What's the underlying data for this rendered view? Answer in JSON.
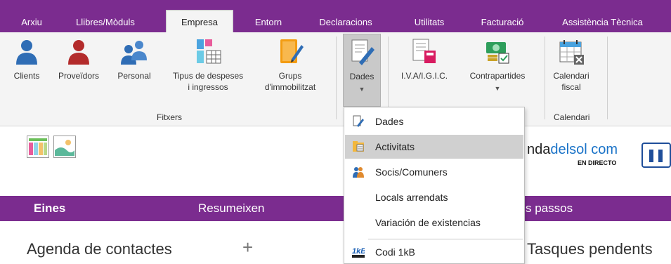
{
  "menubar": {
    "tabs": [
      {
        "label": "Arxiu"
      },
      {
        "label": "Llibres/Mòduls"
      },
      {
        "label": "Empresa"
      },
      {
        "label": "Entorn"
      },
      {
        "label": "Declaracions"
      },
      {
        "label": "Utilitats"
      },
      {
        "label": "Facturació"
      },
      {
        "label": "Assistència Tècnica"
      }
    ],
    "active_tab": "Empresa"
  },
  "ribbon": {
    "buttons": {
      "clients": "Clients",
      "proveidors": "Proveïdors",
      "personal": "Personal",
      "tipus_line1": "Tipus de despeses",
      "tipus_line2": "i ingressos",
      "grups_line1": "Grups",
      "grups_line2": "d'immobilitzat",
      "dades": "Dades",
      "iva": "I.V.A/I.G.I.C.",
      "contrapartides": "Contrapartides",
      "calendari_line1": "Calendari",
      "calendari_line2": "fiscal"
    },
    "groups": {
      "fitxers": "Fitxers",
      "calendari": "Calendari"
    }
  },
  "dropdown": {
    "items": [
      {
        "label": "Dades",
        "icon": "edit-document-icon"
      },
      {
        "label": "Activitats",
        "icon": "folder-list-icon"
      },
      {
        "label": "Socis/Comuners",
        "icon": "partners-icon"
      },
      {
        "label": "Locals arrendats",
        "icon": ""
      },
      {
        "label": "Variación de existencias",
        "icon": ""
      },
      {
        "label": "Codi 1kB",
        "icon": "codi-1kb-icon"
      }
    ],
    "highlighted": "Activitats"
  },
  "content": {
    "brand_part1": "nda",
    "brand_part2": "delsol",
    "brand_part3": "com",
    "brand_sub": "EN DIRECTO",
    "bar": {
      "eines": "Eines",
      "resumeixen": "Resumeixen",
      "passos": "s passos"
    },
    "agenda": "Agenda de contactes",
    "plus": "+",
    "tasques": "Tasques pendents"
  },
  "colors": {
    "accent": "#7b2c8f",
    "blue_person": "#2f6db5",
    "red_person": "#b32b2b",
    "highlight": "#d0d0d0",
    "brand_blue": "#1a73c8"
  }
}
